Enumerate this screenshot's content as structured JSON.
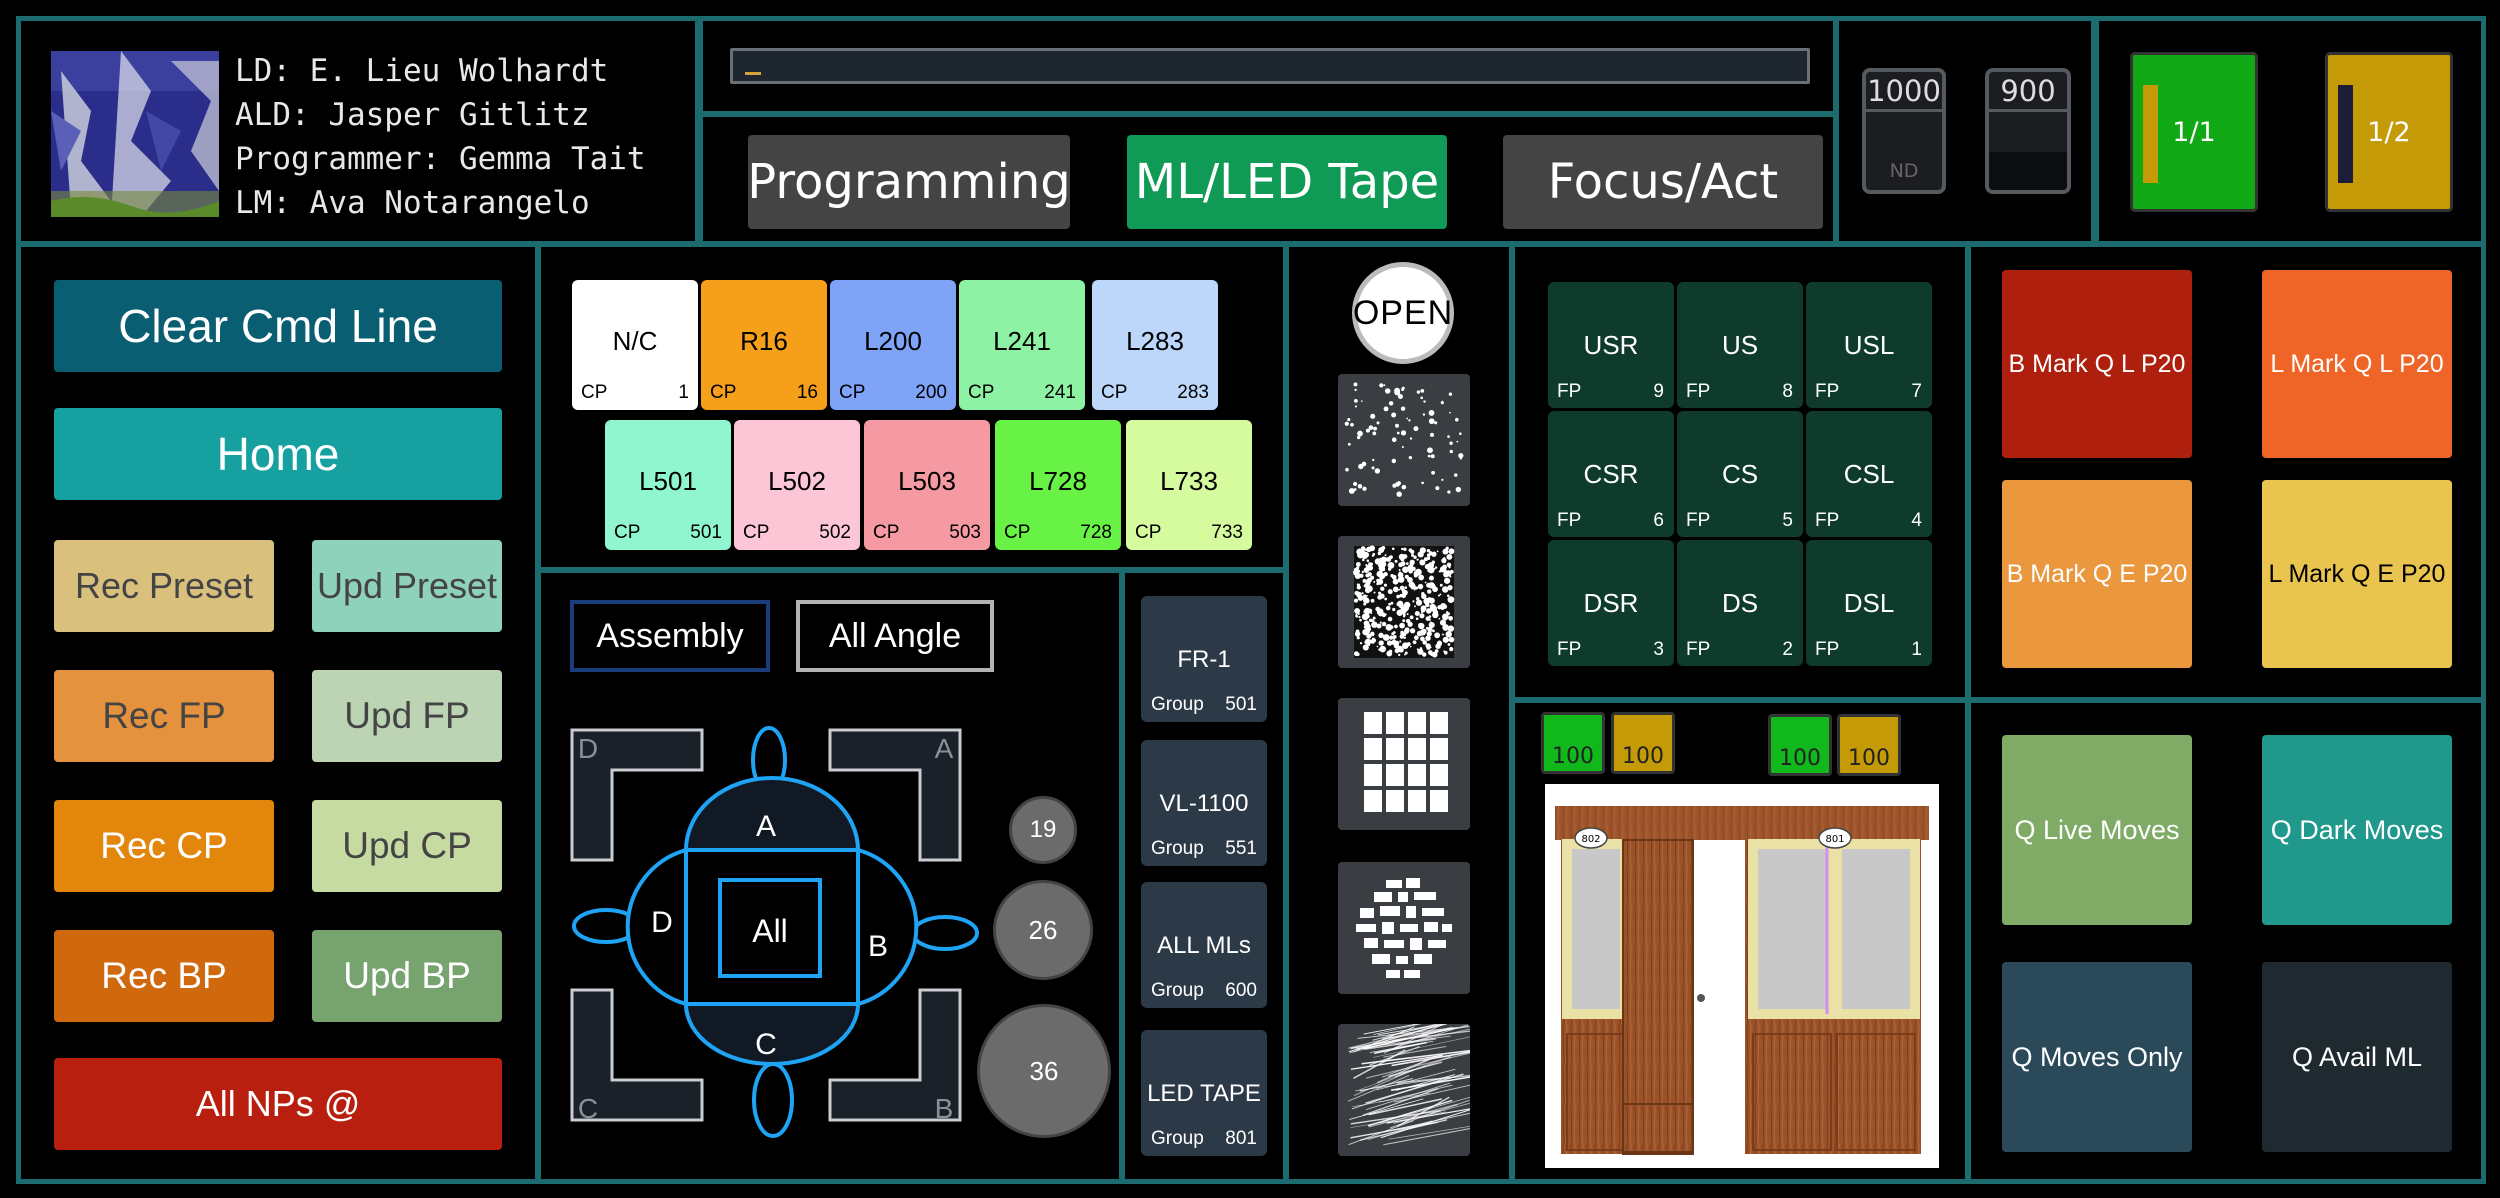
{
  "header": {
    "crew": [
      "LD: E. Lieu Wolhardt",
      "ALD: Jasper Gitlitz",
      "Programmer: Gemma Tait",
      "LM: Ava Notarangelo"
    ],
    "command_line": ""
  },
  "modes": [
    "Programming",
    "ML/LED Tape",
    "Focus/Act"
  ],
  "faders": [
    {
      "label": "1000",
      "sub": "ND"
    },
    {
      "label": "900",
      "sub": ""
    }
  ],
  "pages": [
    "1/1",
    "1/2"
  ],
  "left_buttons": {
    "clear": "Clear Cmd Line",
    "home": "Home",
    "rec_preset": "Rec Preset",
    "upd_preset": "Upd Preset",
    "rec_fp": "Rec FP",
    "upd_fp": "Upd FP",
    "rec_cp": "Rec CP",
    "upd_cp": "Upd CP",
    "rec_bp": "Rec BP",
    "upd_bp": "Upd BP",
    "all_nps": "All NPs @"
  },
  "color_presets": [
    {
      "name": "N/C",
      "type": "CP",
      "num": "1",
      "color": "#ffffff"
    },
    {
      "name": "R16",
      "type": "CP",
      "num": "16",
      "color": "#f59f1a"
    },
    {
      "name": "L200",
      "type": "CP",
      "num": "200",
      "color": "#7fa3f7"
    },
    {
      "name": "L241",
      "type": "CP",
      "num": "241",
      "color": "#8ef2a4"
    },
    {
      "name": "L283",
      "type": "CP",
      "num": "283",
      "color": "#bcd7f9"
    },
    {
      "name": "L501",
      "type": "CP",
      "num": "501",
      "color": "#8ff6cf"
    },
    {
      "name": "L502",
      "type": "CP",
      "num": "502",
      "color": "#fcc6d6"
    },
    {
      "name": "L503",
      "type": "CP",
      "num": "503",
      "color": "#f59aa2"
    },
    {
      "name": "L728",
      "type": "CP",
      "num": "728",
      "color": "#69f246"
    },
    {
      "name": "L733",
      "type": "CP",
      "num": "733",
      "color": "#d5fb9e"
    }
  ],
  "selection": {
    "assembly": "Assembly",
    "all_angle": "All Angle",
    "angles": [
      "A",
      "B",
      "C",
      "D"
    ],
    "center": "All",
    "corners": [
      "D",
      "A",
      "C",
      "B"
    ],
    "circles": [
      "19",
      "26",
      "36"
    ]
  },
  "groups": [
    {
      "name": "FR-1",
      "type": "Group",
      "num": "501"
    },
    {
      "name": "VL-1100",
      "type": "Group",
      "num": "551"
    },
    {
      "name": "ALL MLs",
      "type": "Group",
      "num": "600"
    },
    {
      "name": "LED TAPE",
      "type": "Group",
      "num": "801"
    }
  ],
  "beam": {
    "open": "OPEN",
    "gobos": [
      "dots-gobo-icon",
      "breakup-gobo-icon",
      "grid-gobo-icon",
      "rects-gobo-icon",
      "streaks-gobo-icon"
    ]
  },
  "focus_presets": [
    {
      "name": "USR",
      "type": "FP",
      "num": "9"
    },
    {
      "name": "US",
      "type": "FP",
      "num": "8"
    },
    {
      "name": "USL",
      "type": "FP",
      "num": "7"
    },
    {
      "name": "CSR",
      "type": "FP",
      "num": "6"
    },
    {
      "name": "CS",
      "type": "FP",
      "num": "5"
    },
    {
      "name": "CSL",
      "type": "FP",
      "num": "4"
    },
    {
      "name": "DSR",
      "type": "FP",
      "num": "3"
    },
    {
      "name": "DS",
      "type": "FP",
      "num": "2"
    },
    {
      "name": "DSL",
      "type": "FP",
      "num": "1"
    }
  ],
  "levels": [
    "100",
    "100",
    "100",
    "100"
  ],
  "stage_labels": [
    "802",
    "801"
  ],
  "marks": [
    {
      "label": "B Mark Q L P20",
      "color": "#ae1f0d"
    },
    {
      "label": "L Mark Q L P20",
      "color": "#ef6427"
    },
    {
      "label": "B Mark Q E P20",
      "color": "#ea973e"
    },
    {
      "label": "L Mark Q E P20",
      "color": "#e9c54f"
    }
  ],
  "queues": [
    {
      "label": "Q Live Moves",
      "color": "#7fab67"
    },
    {
      "label": "Q Dark Moves",
      "color": "#21988c"
    },
    {
      "label": "Q Moves Only",
      "color": "#2a4a5a"
    },
    {
      "label": "Q Avail ML",
      "color": "#1f2a30"
    }
  ],
  "colors": {
    "border": "#1b6b6f",
    "active_mode": "#0f9a55",
    "mode_bg": "#444444",
    "page_green": "#10a814",
    "page_gold": "#c49a06"
  }
}
